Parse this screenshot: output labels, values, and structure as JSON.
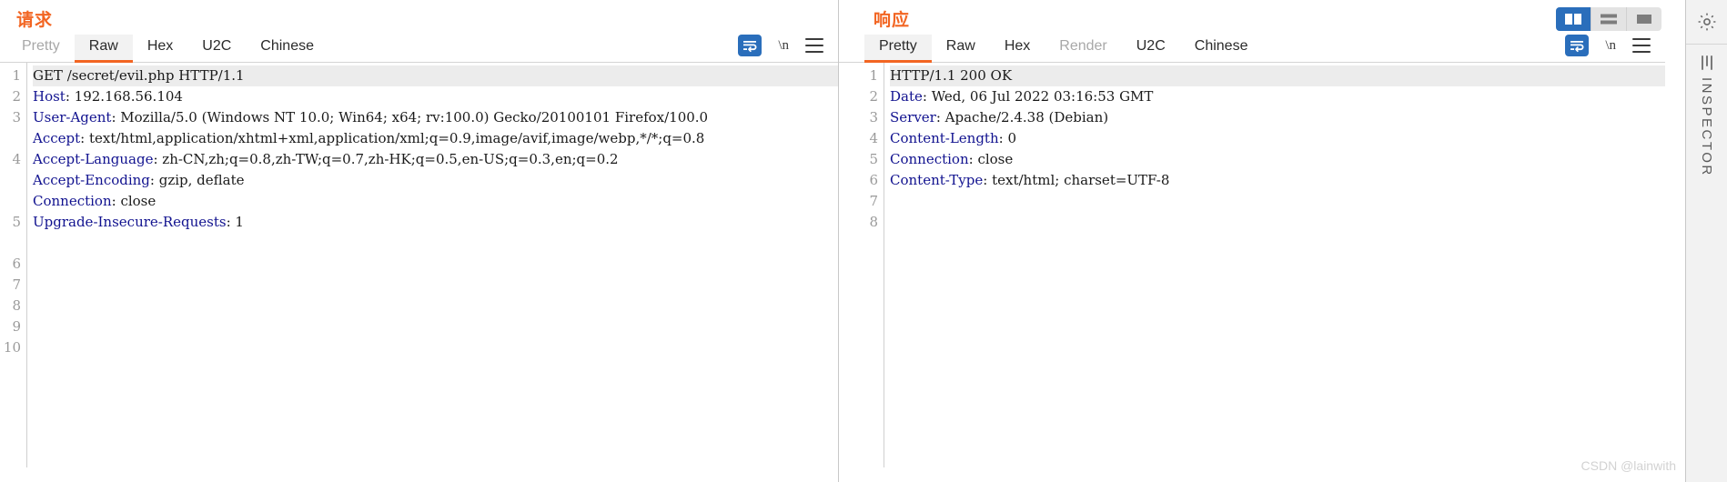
{
  "layout": {
    "buttons": [
      {
        "name": "side-by-side",
        "active": true
      },
      {
        "name": "stacked",
        "active": false
      },
      {
        "name": "single",
        "active": false
      }
    ]
  },
  "right_rail": {
    "gear_icon": "gear-icon",
    "inspector_label": "INSPECTOR"
  },
  "watermark": "CSDN @lainwith",
  "request": {
    "title": "请求",
    "tabs": [
      {
        "label": "Pretty",
        "selected": false,
        "disabled": true
      },
      {
        "label": "Raw",
        "selected": true,
        "disabled": false
      },
      {
        "label": "Hex",
        "selected": false,
        "disabled": false
      },
      {
        "label": "U2C",
        "selected": false,
        "disabled": false
      },
      {
        "label": "Chinese",
        "selected": false,
        "disabled": false
      }
    ],
    "tools": {
      "wrap_icon": "word-wrap-icon",
      "newline_label": "\\n",
      "menu_icon": "hamburger-menu-icon"
    },
    "line_numbers": [
      "1",
      "2",
      "3",
      "",
      "4",
      "",
      "",
      "5",
      "",
      "6",
      "7",
      "8",
      "9",
      "10"
    ],
    "lines": [
      {
        "header": "",
        "value": "GET /secret/evil.php HTTP/1.1",
        "highlight": true
      },
      {
        "header": "Host",
        "value": ": 192.168.56.104",
        "highlight": false
      },
      {
        "header": "User-Agent",
        "value": ": Mozilla/5.0 (Windows NT 10.0; Win64; x64; rv:100.0) Gecko/20100101 Firefox/100.0",
        "highlight": false
      },
      {
        "header": "Accept",
        "value": ": text/html,application/xhtml+xml,application/xml;q=0.9,image/avif,image/webp,*/*;q=0.8",
        "highlight": false
      },
      {
        "header": "Accept-Language",
        "value": ": zh-CN,zh;q=0.8,zh-TW;q=0.7,zh-HK;q=0.5,en-US;q=0.3,en;q=0.2",
        "highlight": false
      },
      {
        "header": "Accept-Encoding",
        "value": ": gzip, deflate",
        "highlight": false
      },
      {
        "header": "Connection",
        "value": ": close",
        "highlight": false
      },
      {
        "header": "Upgrade-Insecure-Requests",
        "value": ": 1",
        "highlight": false
      },
      {
        "header": "",
        "value": "",
        "highlight": false
      },
      {
        "header": "",
        "value": "",
        "highlight": false
      }
    ]
  },
  "response": {
    "title": "响应",
    "tabs": [
      {
        "label": "Pretty",
        "selected": true,
        "disabled": false
      },
      {
        "label": "Raw",
        "selected": false,
        "disabled": false
      },
      {
        "label": "Hex",
        "selected": false,
        "disabled": false
      },
      {
        "label": "Render",
        "selected": false,
        "disabled": true
      },
      {
        "label": "U2C",
        "selected": false,
        "disabled": false
      },
      {
        "label": "Chinese",
        "selected": false,
        "disabled": false
      }
    ],
    "tools": {
      "wrap_icon": "word-wrap-icon",
      "newline_label": "\\n",
      "menu_icon": "hamburger-menu-icon"
    },
    "line_numbers": [
      "1",
      "2",
      "3",
      "4",
      "5",
      "6",
      "7",
      "8"
    ],
    "lines": [
      {
        "header": "",
        "value": "HTTP/1.1 200 OK",
        "highlight": true
      },
      {
        "header": "Date",
        "value": ": Wed, 06 Jul 2022 03:16:53 GMT",
        "highlight": false
      },
      {
        "header": "Server",
        "value": ": Apache/2.4.38 (Debian)",
        "highlight": false
      },
      {
        "header": "Content-Length",
        "value": ": 0",
        "highlight": false
      },
      {
        "header": "Connection",
        "value": ": close",
        "highlight": false
      },
      {
        "header": "Content-Type",
        "value": ": text/html; charset=UTF-8",
        "highlight": false
      },
      {
        "header": "",
        "value": "",
        "highlight": false
      },
      {
        "header": "",
        "value": "",
        "highlight": false
      }
    ]
  }
}
